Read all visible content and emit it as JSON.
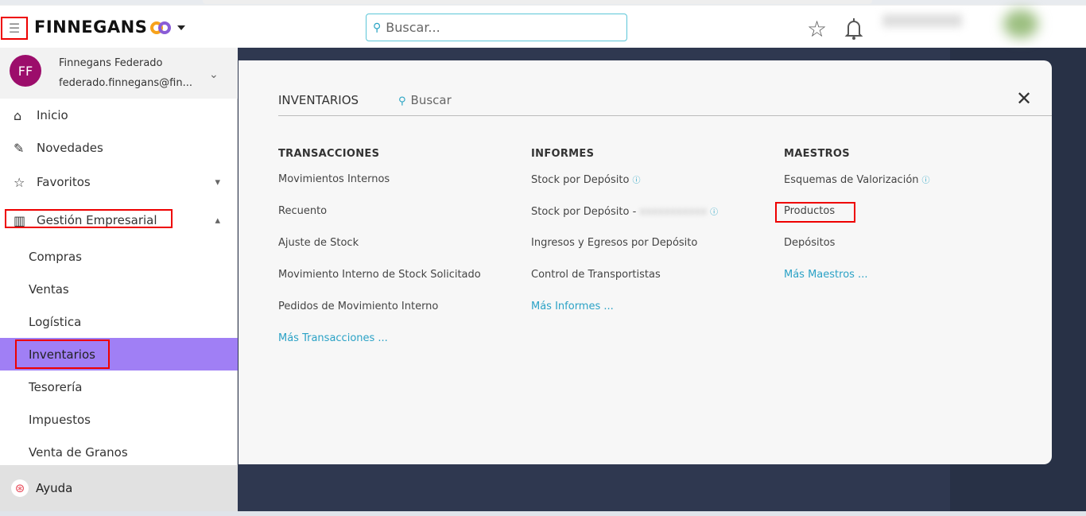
{
  "header": {
    "brand": "FINNEGANS",
    "search_placeholder": "Buscar..."
  },
  "profile": {
    "initials": "FF",
    "name": "Finnegans Federado",
    "email": "federado.finnegans@fin..."
  },
  "nav": [
    {
      "label": "Inicio"
    },
    {
      "label": "Novedades"
    },
    {
      "label": "Favoritos"
    },
    {
      "label": "Gestión Empresarial"
    }
  ],
  "subnav": [
    "Compras",
    "Ventas",
    "Logística",
    "Inventarios",
    "Tesorería",
    "Impuestos",
    "Venta de Granos"
  ],
  "help": "Ayuda",
  "panel": {
    "title": "INVENTARIOS",
    "search_placeholder": "Buscar",
    "columns": [
      {
        "title": "TRANSACCIONES",
        "items": [
          "Movimientos Internos",
          "Recuento",
          "Ajuste de Stock",
          "Movimiento Interno de Stock Solicitado",
          "Pedidos de Movimiento Interno"
        ],
        "more": "Más Transacciones ..."
      },
      {
        "title": "INFORMES",
        "items": [
          "Stock por Depósito",
          "Stock por Depósito -",
          "Ingresos y Egresos por Depósito",
          "Control de Transportistas"
        ],
        "more": "Más Informes ..."
      },
      {
        "title": "MAESTROS",
        "items": [
          "Esquemas de Valorización",
          "Productos",
          "Depósitos"
        ],
        "more": "Más Maestros ..."
      }
    ]
  },
  "colors": {
    "accent": "#a07ff5",
    "avatar": "#9c0d6b",
    "link": "#2ba2c6",
    "highlight": "#ee0000"
  }
}
